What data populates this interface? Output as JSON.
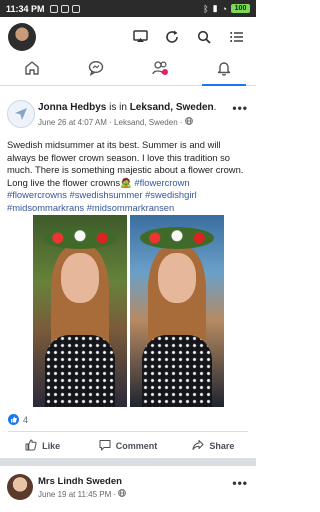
{
  "status_bar": {
    "time": "11:34 PM",
    "battery": "100"
  },
  "header": {
    "icons": [
      "cast-icon",
      "refresh-icon",
      "search-icon",
      "menu-icon"
    ]
  },
  "tabs": [
    {
      "name": "home",
      "icon": "home-icon"
    },
    {
      "name": "messages",
      "icon": "chat-icon"
    },
    {
      "name": "friends",
      "icon": "friends-icon"
    },
    {
      "name": "notifications",
      "icon": "bell-icon",
      "active": true
    }
  ],
  "post": {
    "author": "Jonna Hedbys",
    "connector": " is in ",
    "location": "Leksand, Sweden",
    "location_suffix": ".",
    "meta": "June 26 at 4:07 AM · Leksand, Sweden ·",
    "text_plain": "Swedish midsummer at its best. Summer is and will always be flower crown season. I love this tradition so much. There is something majestic about a flower crown. Long live the flower crowns🧟 ",
    "hashtags": "#flowercrown #flowercrowns #swedishsummer #swedishgirl #midsommarkrans #midsommarkransen",
    "reaction_count": "4",
    "actions": {
      "like": "Like",
      "comment": "Comment",
      "share": "Share"
    }
  },
  "post2": {
    "author": "Mrs Lindh Sweden",
    "meta": "June 19 at 11:45 PM ·"
  },
  "colors": {
    "accent": "#1877f2",
    "hashtag": "#385898",
    "status_bar": "#2b2b2b"
  }
}
